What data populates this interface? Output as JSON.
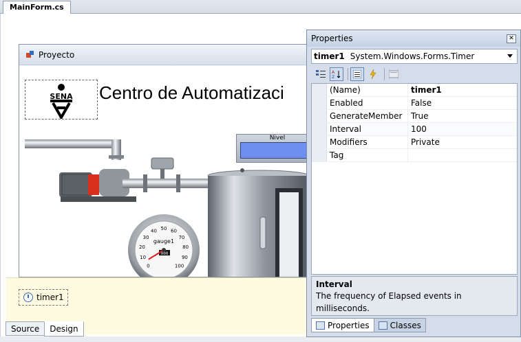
{
  "document_tab": {
    "label": "MainForm.cs"
  },
  "form": {
    "title": "Proyecto",
    "heading": "Centro de Automatizaci",
    "logo_text": "SENA",
    "level_display_label": "Nivel",
    "gauge": {
      "label": "gauge1",
      "ticks": [
        "0",
        "10",
        "20",
        "30",
        "40",
        "50",
        "60",
        "70",
        "80",
        "90",
        "100"
      ],
      "value_readout": "000",
      "min": 0,
      "max": 100,
      "needle_value": 5
    }
  },
  "component_tray": {
    "items": [
      {
        "label": "timer1",
        "icon": "clock-icon"
      }
    ]
  },
  "view_tabs": [
    {
      "label": "Source"
    },
    {
      "label": "Design",
      "active": true
    }
  ],
  "properties": {
    "title": "Properties",
    "selected_object": {
      "name": "timer1",
      "type": "System.Windows.Forms.Timer"
    },
    "toolbar": [
      "categorized-icon",
      "alphabetical-icon",
      "properties-icon",
      "events-icon",
      "property-pages-icon"
    ],
    "rows": [
      {
        "name": "(Name)",
        "value": "timer1"
      },
      {
        "name": "Enabled",
        "value": "False"
      },
      {
        "name": "GenerateMember",
        "value": "True"
      },
      {
        "name": "Interval",
        "value": "100"
      },
      {
        "name": "Modifiers",
        "value": "Private"
      },
      {
        "name": "Tag",
        "value": ""
      }
    ],
    "description": {
      "title": "Interval",
      "text": "The frequency of Elapsed events in milliseconds."
    },
    "tabs": [
      {
        "label": "Properties",
        "active": true
      },
      {
        "label": "Classes"
      }
    ]
  },
  "colors": {
    "tray_background": "#fffbe1",
    "level_screen": "#6f8ff0",
    "pump_red": "#d9301e"
  }
}
